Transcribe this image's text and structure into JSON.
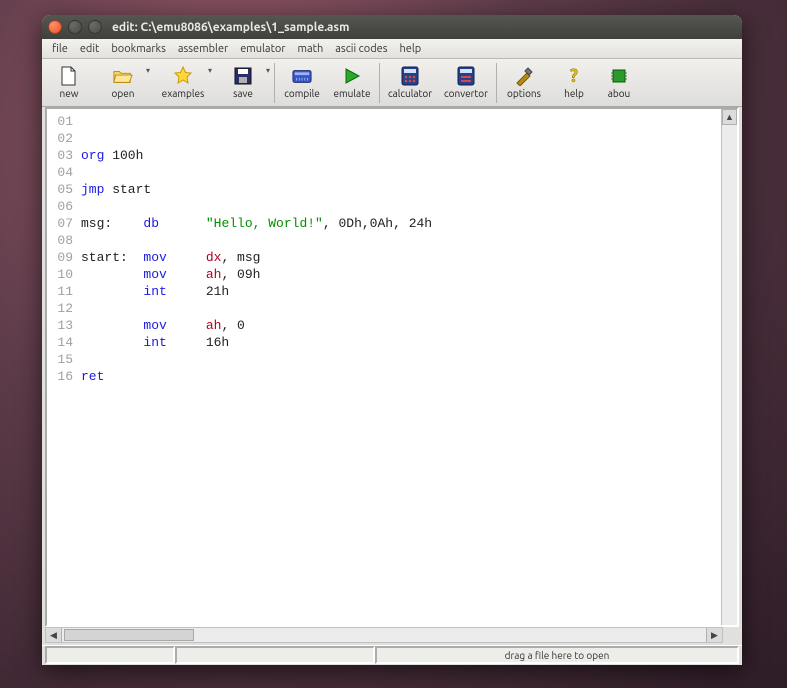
{
  "titlebar": {
    "title": "edit: C:\\emu8086\\examples\\1_sample.asm"
  },
  "menubar": {
    "items": [
      "file",
      "edit",
      "bookmarks",
      "assembler",
      "emulator",
      "math",
      "ascii codes",
      "help"
    ]
  },
  "toolbar": {
    "new": "new",
    "open": "open",
    "examples": "examples",
    "save": "save",
    "compile": "compile",
    "emulate": "emulate",
    "calculator": "calculator",
    "convertor": "convertor",
    "options": "options",
    "help": "help",
    "about": "abou"
  },
  "code": {
    "line_nums": "01\n02\n03\n04\n05\n06\n07\n08\n09\n10\n11\n12\n13\n14\n15\n16",
    "l3_a": "org",
    "l3_b": " 100h",
    "l5_a": "jmp",
    "l5_b": " start",
    "l7_a": "msg:    ",
    "l7_b": "db",
    "l7_c": "      ",
    "l7_d": "\"Hello, World!\"",
    "l7_e": ", 0Dh,0Ah, 24h",
    "l9_a": "start:  ",
    "l9_b": "mov",
    "l9_c": "     ",
    "l9_d": "dx",
    "l9_e": ", msg",
    "l10_a": "        ",
    "l10_b": "mov",
    "l10_c": "     ",
    "l10_d": "ah",
    "l10_e": ", 09h",
    "l11_a": "        ",
    "l11_b": "int",
    "l11_c": "     21h",
    "l13_a": "        ",
    "l13_b": "mov",
    "l13_c": "     ",
    "l13_d": "ah",
    "l13_e": ", 0",
    "l14_a": "        ",
    "l14_b": "int",
    "l14_c": "     16h",
    "l16_a": "ret"
  },
  "statusbar": {
    "drop_hint": "drag a file here to open"
  }
}
